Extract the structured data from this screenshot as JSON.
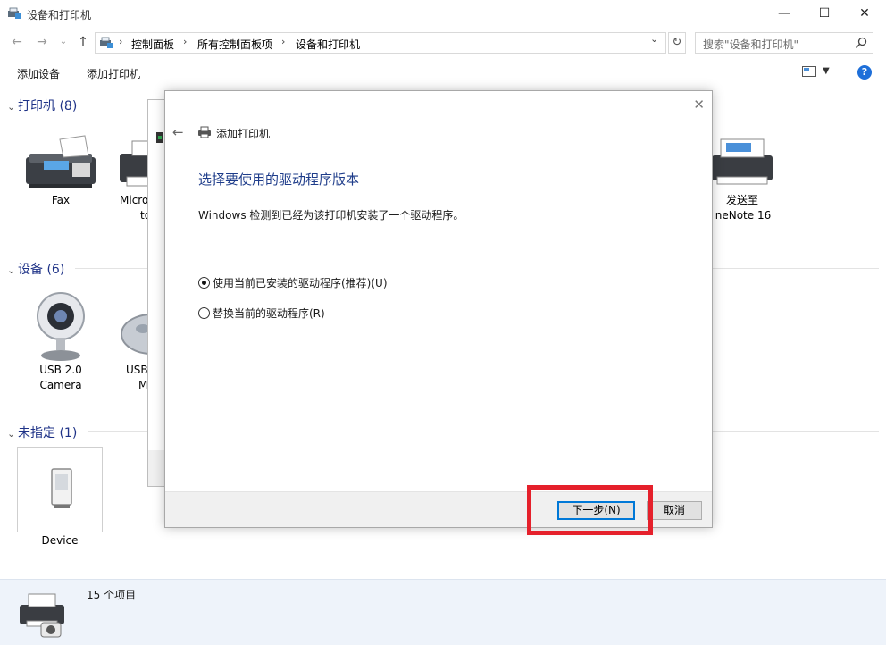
{
  "window": {
    "title": "设备和打印机"
  },
  "address": {
    "crumbs": [
      "控制面板",
      "所有控制面板项",
      "设备和打印机"
    ],
    "search_placeholder": "搜索\"设备和打印机\""
  },
  "toolbar": {
    "add_device": "添加设备",
    "add_printer": "添加打印机"
  },
  "groups": {
    "printers": {
      "label": "打印机 (8)",
      "items": [
        "Fax",
        "Micro",
        "to",
        "发送至",
        "neNote 16"
      ]
    },
    "devices": {
      "label": "设备 (6)",
      "items": [
        "USB 2.0",
        "Camera",
        "USB",
        "M"
      ]
    },
    "unspecified": {
      "label": "未指定 (1)",
      "items": [
        "Device"
      ]
    }
  },
  "status": {
    "count": "15 个项目"
  },
  "dialog": {
    "title": "添加打印机",
    "heading": "选择要使用的驱动程序版本",
    "description": "Windows 检测到已经为该打印机安装了一个驱动程序。",
    "options": [
      {
        "label": "使用当前已安装的驱动程序(推荐)(U)",
        "selected": true
      },
      {
        "label": "替换当前的驱动程序(R)",
        "selected": false
      }
    ],
    "next_button": "下一步(N)",
    "cancel_button": "取消"
  },
  "colors": {
    "heading_blue": "#1e3c8a",
    "highlight_red": "#e5202b",
    "status_bg": "#eef3fa"
  }
}
